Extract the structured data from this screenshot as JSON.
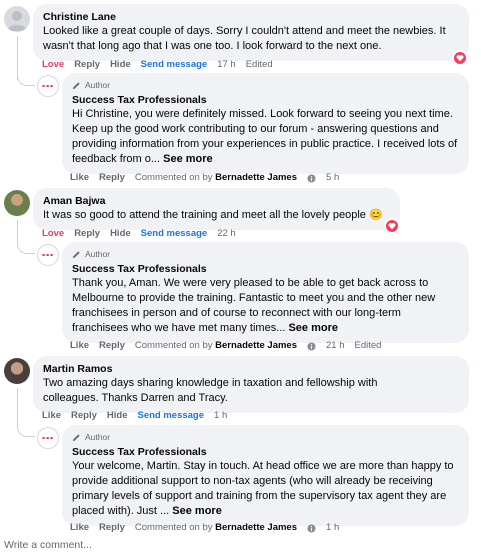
{
  "labels": {
    "love": "Love",
    "like": "Like",
    "reply": "Reply",
    "hide": "Hide",
    "send_message": "Send message",
    "edited": "Edited",
    "author": "Author",
    "see_more": "See more",
    "commented_on_by": "Commented on by",
    "write_comment": "Write a comment..."
  },
  "colors": {
    "bubble_bg": "#f0f2f5",
    "love_red": "#e4405f",
    "link_blue": "#1b74e4",
    "muted": "#65676b",
    "heart_badge": "#f33e58"
  },
  "comments": [
    {
      "author": "Christine Lane",
      "text": "Looked like a great couple of days. Sorry I couldn't attend and meet the newbies. It wasn't that long ago that I was one too. I look forward to the next one.",
      "time": "17 h",
      "edited": true,
      "loved": true,
      "reply": {
        "author": "Success Tax Professionals",
        "text": "Hi Christine, you were definitely missed. Look forward to seeing you next time. Keep up the good work contributing to our forum - answering questions and providing information from your experiences in public practice. I received lots of feedback from o...",
        "commenter": "Bernadette James",
        "time": "5 h"
      }
    },
    {
      "author": "Aman Bajwa",
      "text": "It was so good to attend the training and meet all the lovely people",
      "emoji": "😊",
      "time": "22 h",
      "loved": true,
      "reply": {
        "author": "Success Tax Professionals",
        "text": "Thank you, Aman. We were very pleased to be able to get back across to Melbourne to provide the training. Fantastic to meet you and the other new franchisees in person and of course to reconnect with our long-term franchisees who we have met many times...",
        "commenter": "Bernadette James",
        "time": "21 h",
        "edited": true
      }
    },
    {
      "author": "Martin Ramos",
      "text": "Two amazing days sharing knowledge in taxation and fellowship with colleagues. Thanks Darren and Tracy.",
      "time": "1 h",
      "loved": false,
      "reply": {
        "author": "Success Tax Professionals",
        "text": "Your welcome, Martin. Stay in touch. At head office we are more than happy to provide additional support to non-tax agents (who will already be receiving primary levels of support and training from the supervisory tax agent they are placed with). Just ...",
        "commenter": "Bernadette James",
        "time": "1 h"
      }
    }
  ]
}
